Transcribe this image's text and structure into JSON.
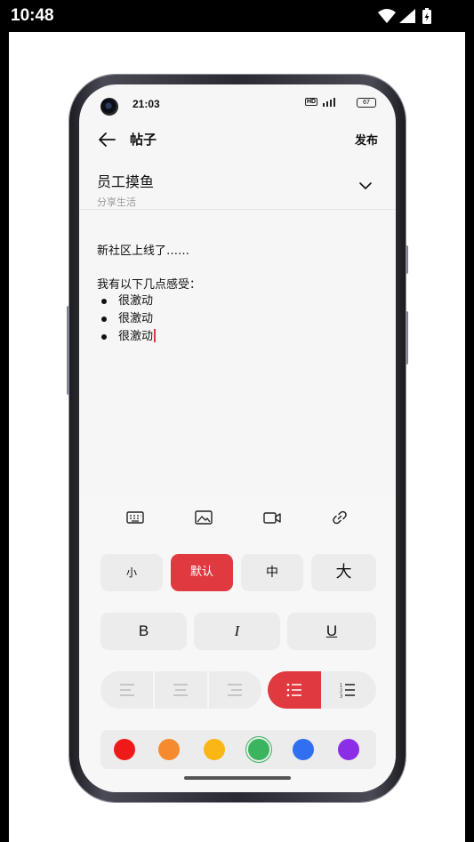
{
  "os_status": {
    "time": "10:48"
  },
  "phone_status": {
    "time": "21:03",
    "hd": "HD",
    "battery": "67"
  },
  "header": {
    "title": "帖子",
    "publish_label": "发布"
  },
  "community": {
    "name": "员工摸鱼",
    "subtitle": "分享生活"
  },
  "editor": {
    "first_line": "新社区上线了……",
    "intro": "我有以下几点感受：",
    "bullets": [
      "很激动",
      "很激动",
      "很激动"
    ]
  },
  "toolbar": {
    "insert_icons": [
      "keyboard-icon",
      "image-icon",
      "video-icon",
      "link-icon"
    ],
    "sizes": [
      {
        "label": "小",
        "active": false
      },
      {
        "label": "默认",
        "active": true
      },
      {
        "label": "中",
        "active": false
      },
      {
        "label": "大",
        "active": false
      }
    ],
    "styles": {
      "bold": "B",
      "italic": "I",
      "underline": "U"
    },
    "list_style_selected": "bullet",
    "colors": [
      {
        "name": "red",
        "hex": "#f01919"
      },
      {
        "name": "orange",
        "hex": "#f58a2e"
      },
      {
        "name": "yellow",
        "hex": "#fbb515"
      },
      {
        "name": "green",
        "hex": "#3bb55d",
        "selected": true
      },
      {
        "name": "blue",
        "hex": "#2f6ff0"
      },
      {
        "name": "purple",
        "hex": "#8b2ee8"
      }
    ]
  },
  "accent_color": "#e0393f"
}
